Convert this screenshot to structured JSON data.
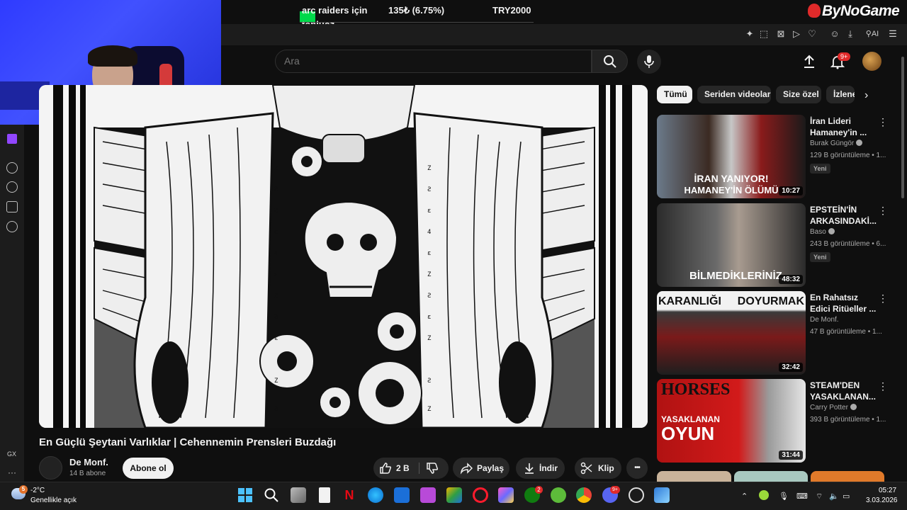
{
  "stream_overlay": {
    "ticker_game": "arc raiders için",
    "ticker_amount": "135₺ (6.75%)",
    "ticker_goal": "TRY2000",
    "ticker_user": "topluoz",
    "brand": "ByNoGame"
  },
  "header": {
    "search_placeholder": "Ara",
    "notification_badge": "9+"
  },
  "video": {
    "title": "En Güçlü Şeytani Varlıklar | Cehennemin Prensleri Buzdağı",
    "channel": "De Monf.",
    "subscribers": "14 B abone",
    "subscribe_label": "Abone ol",
    "likes": "2 B",
    "share_label": "Paylaş",
    "download_label": "İndir",
    "clip_label": "Klip",
    "more_label": "•••"
  },
  "filters": {
    "chips": [
      "Tümü",
      "Seriden videolar",
      "Size özel",
      "İzlenen"
    ]
  },
  "recommendations": [
    {
      "title_line1": "İran Lideri",
      "title_line2": "Hamaney'in ...",
      "channel": "Burak Güngör",
      "views": "129 B görüntüleme • 1...",
      "badge": "Yeni",
      "duration": "10:27",
      "thumb_text1": "İRAN YANIYOR!",
      "thumb_text2": "HAMANEY'İN ÖLÜMÜ"
    },
    {
      "title_line1": "EPSTEİN'İN",
      "title_line2": "ARKASINDAKİ...",
      "channel": "Baso",
      "views": "243 B görüntüleme • 6...",
      "badge": "Yeni",
      "duration": "48:32",
      "thumb_text1": "BİLMEDİKLERİNİZ"
    },
    {
      "title_line1": "En Rahatsız",
      "title_line2": "Edici Ritüeller ...",
      "channel": "De Monf.",
      "views": "47 B görüntüleme • 1...",
      "duration": "32:42",
      "thumb_text1": "KARANLIĞI",
      "thumb_text2": "DOYURMAK"
    },
    {
      "title_line1": "STEAM'DEN",
      "title_line2": "YASAKLANAN...",
      "channel": "Carry Potter",
      "views": "393 B görüntüleme • 1...",
      "duration": "31:44",
      "thumb_text1": "HORSES",
      "thumb_text2": "YASAKLANAN",
      "thumb_text3": "OYUN"
    }
  ],
  "sidebar": {
    "gx_label": "GX",
    "dots": "···"
  },
  "taskbar": {
    "weather_badge": "5",
    "temperature": "-2°C",
    "weather_desc": "Genellikle açık",
    "time": "05:27",
    "date": "3.03.2026",
    "xbox_badge": "2",
    "discord_badge": "9+"
  },
  "colors": {
    "background": "#0f0f0f",
    "chip_bg": "#272727",
    "accent_red": "#e02a2a",
    "twitch": "#9146ff",
    "webcam_blue": "#3542ff"
  }
}
